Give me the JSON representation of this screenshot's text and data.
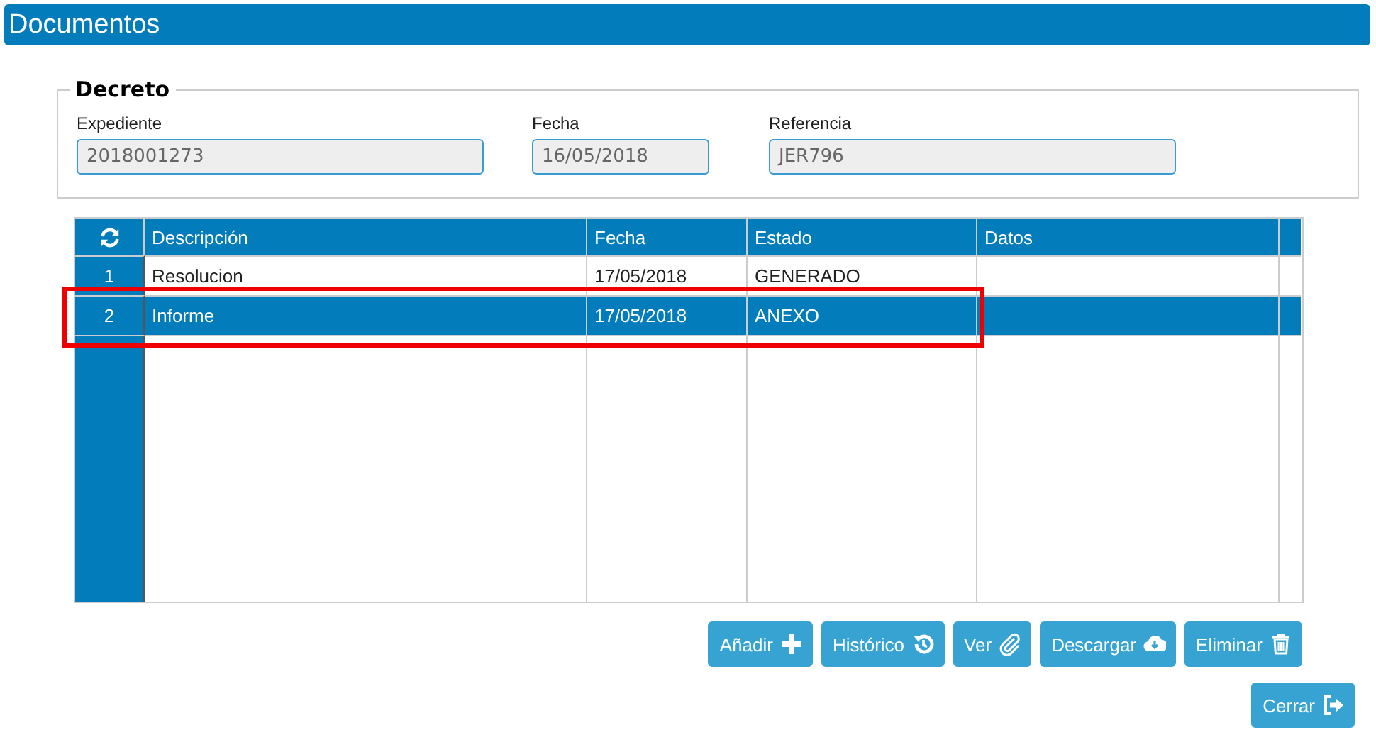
{
  "window": {
    "title": "Documentos"
  },
  "decreto": {
    "legend": "Decreto",
    "fields": [
      {
        "label": "Expediente",
        "value": "2018001273",
        "disabled": true
      },
      {
        "label": "Fecha",
        "value": "16/05/2018",
        "disabled": true
      },
      {
        "label": "Referencia",
        "value": "JER796",
        "disabled": true
      }
    ]
  },
  "table": {
    "columns": [
      "Descripción",
      "Fecha",
      "Estado",
      "Datos"
    ],
    "rows": [
      {
        "index": "1",
        "cells": [
          "Resolucion",
          "17/05/2018",
          "GENERADO",
          ""
        ],
        "selected": false
      },
      {
        "index": "2",
        "cells": [
          "Informe",
          "17/05/2018",
          "ANEXO",
          ""
        ],
        "selected": true,
        "highlighted": true
      }
    ]
  },
  "buttons": [
    {
      "label": "Añadir",
      "kind": "plus"
    },
    {
      "label": "Histórico",
      "kind": "history"
    },
    {
      "label": "Ver",
      "kind": "clip"
    },
    {
      "label": "Descargar",
      "kind": "download"
    },
    {
      "label": "Eliminar",
      "kind": "trash"
    }
  ],
  "close_button": {
    "label": "Cerrar",
    "kind": "exit"
  }
}
